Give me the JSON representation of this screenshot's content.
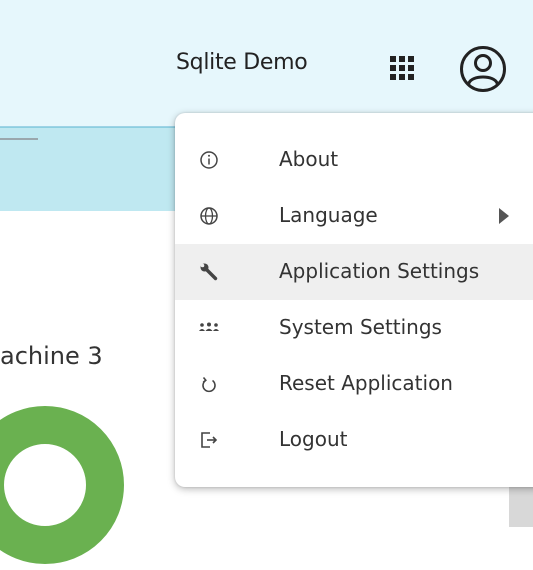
{
  "header": {
    "app_title": "Sqlite Demo",
    "apps_icon": "grid-apps-icon",
    "account_icon": "user-account-icon"
  },
  "main": {
    "card_title_fragment": "achine 3",
    "donut_color": "#6ab150"
  },
  "menu": {
    "items": [
      {
        "label": "About",
        "icon": "info-icon"
      },
      {
        "label": "Language",
        "icon": "globe-icon",
        "has_submenu": true
      },
      {
        "label": "Application Settings",
        "icon": "wrench-icon",
        "active": true
      },
      {
        "label": "System Settings",
        "icon": "users-icon"
      },
      {
        "label": "Reset Application",
        "icon": "reset-icon"
      },
      {
        "label": "Logout",
        "icon": "logout-icon"
      }
    ]
  },
  "colors": {
    "topbar_bg": "#e6f7fc",
    "subbar_bg": "#bfe8f1",
    "menu_hover_bg": "#efefef",
    "accent_green": "#6ab150"
  }
}
